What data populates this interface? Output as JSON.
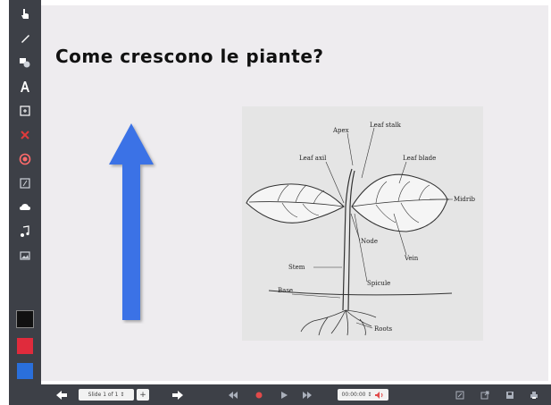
{
  "slide": {
    "title": "Come crescono le piante?"
  },
  "figure": {
    "labels": {
      "apex": "Apex",
      "leaf_stalk": "Leaf stalk",
      "leaf_axil": "Leaf axil",
      "leaf_blade": "Leaf blade",
      "midrib": "Midrib",
      "node": "Node",
      "vein": "Vein",
      "stem": "Stem",
      "spicule": "Spicule",
      "base": "Base",
      "roots": "Roots"
    }
  },
  "toolbar": {
    "tools": [
      "hand-pointer-icon",
      "pen-icon",
      "shapes-icon",
      "text-icon",
      "textbox-icon",
      "eraser-icon",
      "record-icon",
      "note-icon",
      "cloud-icon",
      "audio-icon",
      "image-icon"
    ],
    "colors": {
      "black": "#111111",
      "red": "#e02b3c",
      "blue": "#2a6fdb"
    }
  },
  "bottombar": {
    "slide_indicator": "Slide 1 of 1 ↕",
    "add_label": "+",
    "timer": "00:00:00 ↕",
    "accent_record": "#e24a4a"
  },
  "colors": {
    "arrow": "#3a72e6",
    "toolbar_bg": "#3d4047",
    "canvas_bg": "#eeecef"
  }
}
